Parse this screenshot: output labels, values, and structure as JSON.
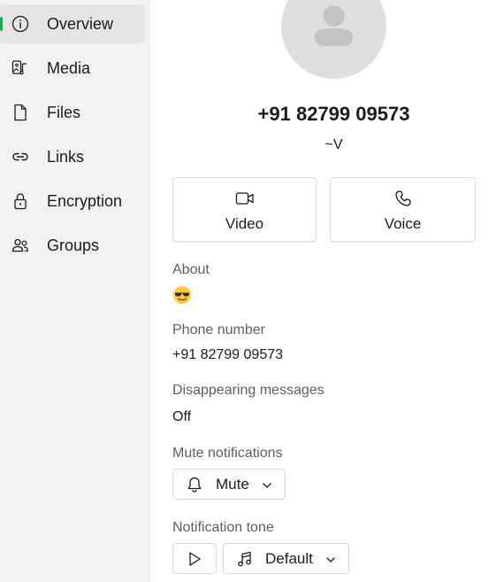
{
  "sidebar": {
    "items": [
      {
        "label": "Overview",
        "icon": "info-icon",
        "active": true
      },
      {
        "label": "Media",
        "icon": "media-icon",
        "active": false
      },
      {
        "label": "Files",
        "icon": "file-icon",
        "active": false
      },
      {
        "label": "Links",
        "icon": "link-icon",
        "active": false
      },
      {
        "label": "Encryption",
        "icon": "lock-icon",
        "active": false
      },
      {
        "label": "Groups",
        "icon": "people-icon",
        "active": false
      }
    ],
    "accent_color": "#1fa855"
  },
  "contact": {
    "phone": "+91 82799 09573",
    "name": "~V"
  },
  "actions": {
    "video_label": "Video",
    "voice_label": "Voice"
  },
  "about": {
    "label": "About",
    "value_emoji": "smiling-face-with-sunglasses"
  },
  "phone_number": {
    "label": "Phone number",
    "value": "+91 82799 09573"
  },
  "disappearing": {
    "label": "Disappearing messages",
    "value": "Off"
  },
  "mute": {
    "label": "Mute notifications",
    "button_label": "Mute"
  },
  "tone": {
    "label": "Notification tone",
    "selected": "Default"
  }
}
